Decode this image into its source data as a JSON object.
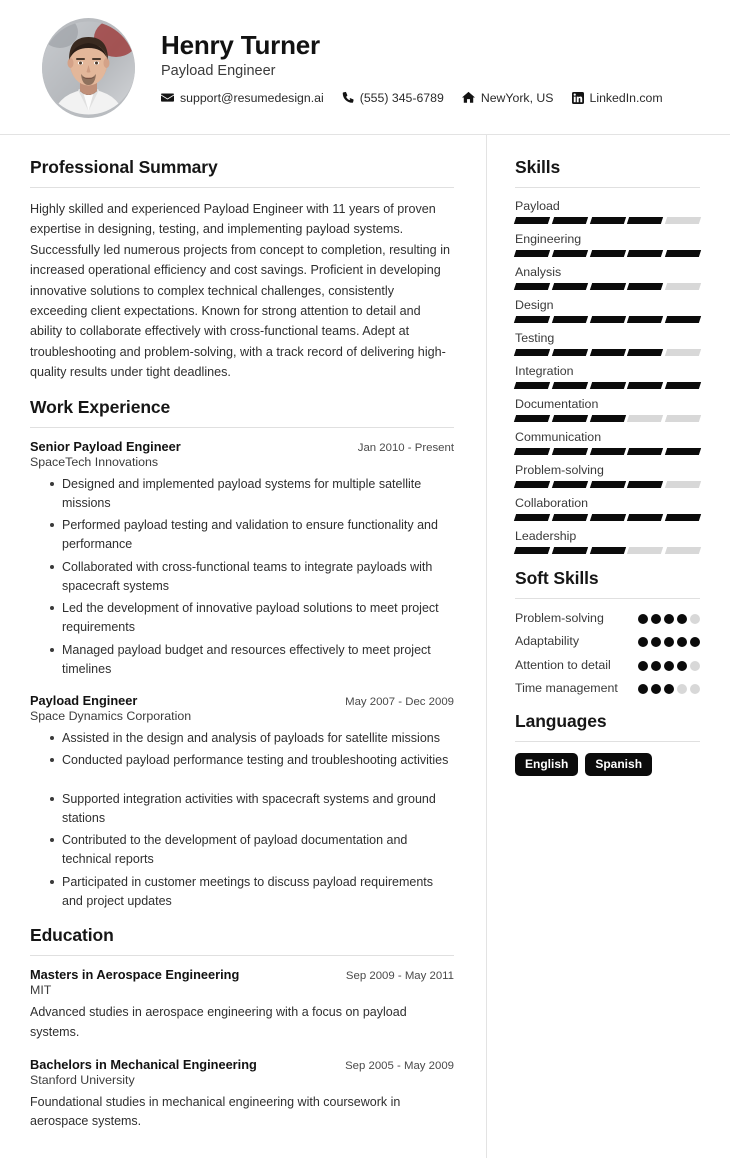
{
  "header": {
    "name": "Henry Turner",
    "job_title": "Payload Engineer",
    "avatar_alt": "profile-photo",
    "contacts": [
      {
        "icon": "envelope-icon",
        "text": "support@resumedesign.ai"
      },
      {
        "icon": "phone-icon",
        "text": "(555) 345-6789"
      },
      {
        "icon": "home-icon",
        "text": "NewYork, US"
      },
      {
        "icon": "linkedin-icon",
        "text": "LinkedIn.com"
      }
    ]
  },
  "summary": {
    "title": "Professional Summary",
    "text": "Highly skilled and experienced Payload Engineer with 11 years of proven expertise in designing, testing, and implementing payload systems. Successfully led numerous projects from concept to completion, resulting in increased operational efficiency and cost savings. Proficient in developing innovative solutions to complex technical challenges, consistently exceeding client expectations. Known for strong attention to detail and ability to collaborate effectively with cross-functional teams. Adept at troubleshooting and problem-solving, with a track record of delivering high-quality results under tight deadlines."
  },
  "experience": {
    "title": "Work Experience",
    "entries": [
      {
        "role": "Senior Payload Engineer",
        "date": "Jan 2010 - Present",
        "company": "SpaceTech Innovations",
        "bullets": [
          "Designed and implemented payload systems for multiple satellite missions",
          "Performed payload testing and validation to ensure functionality and performance",
          "Collaborated with cross-functional teams to integrate payloads with spacecraft systems",
          "Led the development of innovative payload solutions to meet project requirements",
          "Managed payload budget and resources effectively to meet project timelines"
        ]
      },
      {
        "role": "Payload Engineer",
        "date": "May 2007 - Dec 2009",
        "company": "Space Dynamics Corporation",
        "bullets": [
          "Assisted in the design and analysis of payloads for satellite missions",
          "Conducted payload performance testing and troubleshooting activities",
          "Supported integration activities with spacecraft systems and ground stations",
          "Contributed to the development of payload documentation and technical reports",
          "Participated in customer meetings to discuss payload requirements and project updates"
        ]
      }
    ]
  },
  "education": {
    "title": "Education",
    "entries": [
      {
        "degree": "Masters in Aerospace Engineering",
        "date": "Sep 2009 - May 2011",
        "school": "MIT",
        "description": "Advanced studies in aerospace engineering with a focus on payload systems."
      },
      {
        "degree": "Bachelors in Mechanical Engineering",
        "date": "Sep 2005 - May 2009",
        "school": "Stanford University",
        "description": "Foundational studies in mechanical engineering with coursework in aerospace systems."
      }
    ]
  },
  "skills": {
    "title": "Skills",
    "max": 5,
    "items": [
      {
        "name": "Payload",
        "level": 4
      },
      {
        "name": "Engineering",
        "level": 5
      },
      {
        "name": "Analysis",
        "level": 4
      },
      {
        "name": "Design",
        "level": 5
      },
      {
        "name": "Testing",
        "level": 4
      },
      {
        "name": "Integration",
        "level": 5
      },
      {
        "name": "Documentation",
        "level": 3
      },
      {
        "name": "Communication",
        "level": 5
      },
      {
        "name": "Problem-solving",
        "level": 4
      },
      {
        "name": "Collaboration",
        "level": 5
      },
      {
        "name": "Leadership",
        "level": 3
      }
    ]
  },
  "soft_skills": {
    "title": "Soft Skills",
    "max": 5,
    "items": [
      {
        "name": "Problem-solving",
        "level": 4
      },
      {
        "name": "Adaptability",
        "level": 5
      },
      {
        "name": "Attention to detail",
        "level": 4
      },
      {
        "name": "Time management",
        "level": 3
      }
    ]
  },
  "languages": {
    "title": "Languages",
    "items": [
      "English",
      "Spanish"
    ]
  },
  "colors": {
    "accent": "#0b0b0b",
    "track": "#d8d8d8",
    "rule": "#e0e0e0",
    "text": "#333333"
  }
}
